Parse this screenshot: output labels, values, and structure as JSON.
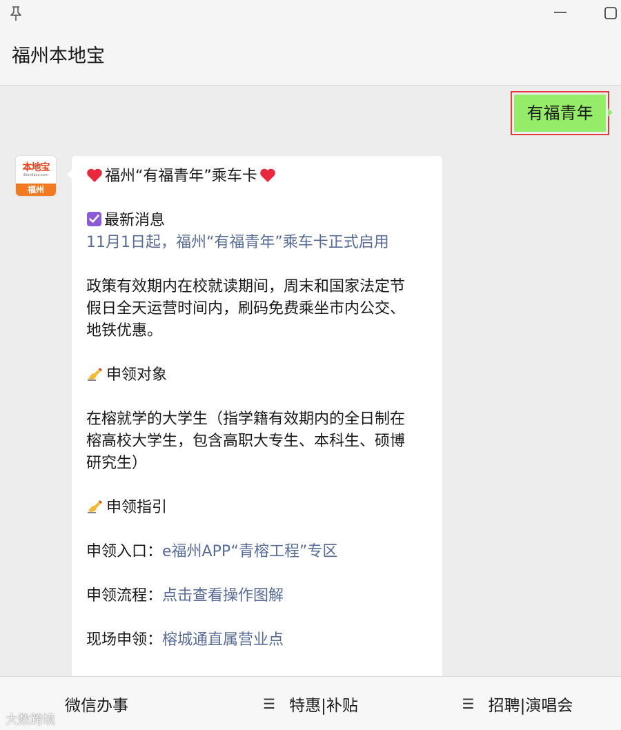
{
  "window": {
    "title": "福州本地宝",
    "icons": [
      "pin-icon",
      "minimize-icon",
      "maximize-icon"
    ]
  },
  "sent_message": {
    "text": "有福青年",
    "bubble_color": "#95ec69",
    "highlight_color": "#e23b3b"
  },
  "avatar": {
    "logo_text": "本地宝",
    "domain_text": "Bendibao.com",
    "city": "福州"
  },
  "received_message": {
    "heading": "福州“有福青年”乘车卡",
    "news_title": "最新消息",
    "news_link": "11月1日起，福州“有福青年”乘车卡正式启用",
    "policy_lines": [
      "政策有效期内在校就读期间，周末和国家法定节",
      "假日全天运营时间内，刷码免费乘坐市内公交、",
      "地铁优惠。"
    ],
    "target_title": "申领对象",
    "target_lines": [
      "在榕就学的大学生（指学籍有效期内的全日制在",
      "榕高校大学生，包含高职大专生、本科生、硕博",
      "研究生）"
    ],
    "guide_title": "申领指引",
    "entry": {
      "label": "申领入口：",
      "link": "e福州APP“青榕工程”专区"
    },
    "process": {
      "label": "申领流程：",
      "link": "点击查看操作图解"
    },
    "onsite": {
      "label": "现场申领：",
      "link": "榕城通直属营业点"
    },
    "link_color": "#576b95"
  },
  "bottom_menu": {
    "items": [
      {
        "label": "微信办事",
        "icon": ""
      },
      {
        "label": "特惠|补贴",
        "icon": "hamburger-icon"
      },
      {
        "label": "招聘|演唱会",
        "icon": "hamburger-icon"
      }
    ]
  },
  "watermark": "大数跨境"
}
